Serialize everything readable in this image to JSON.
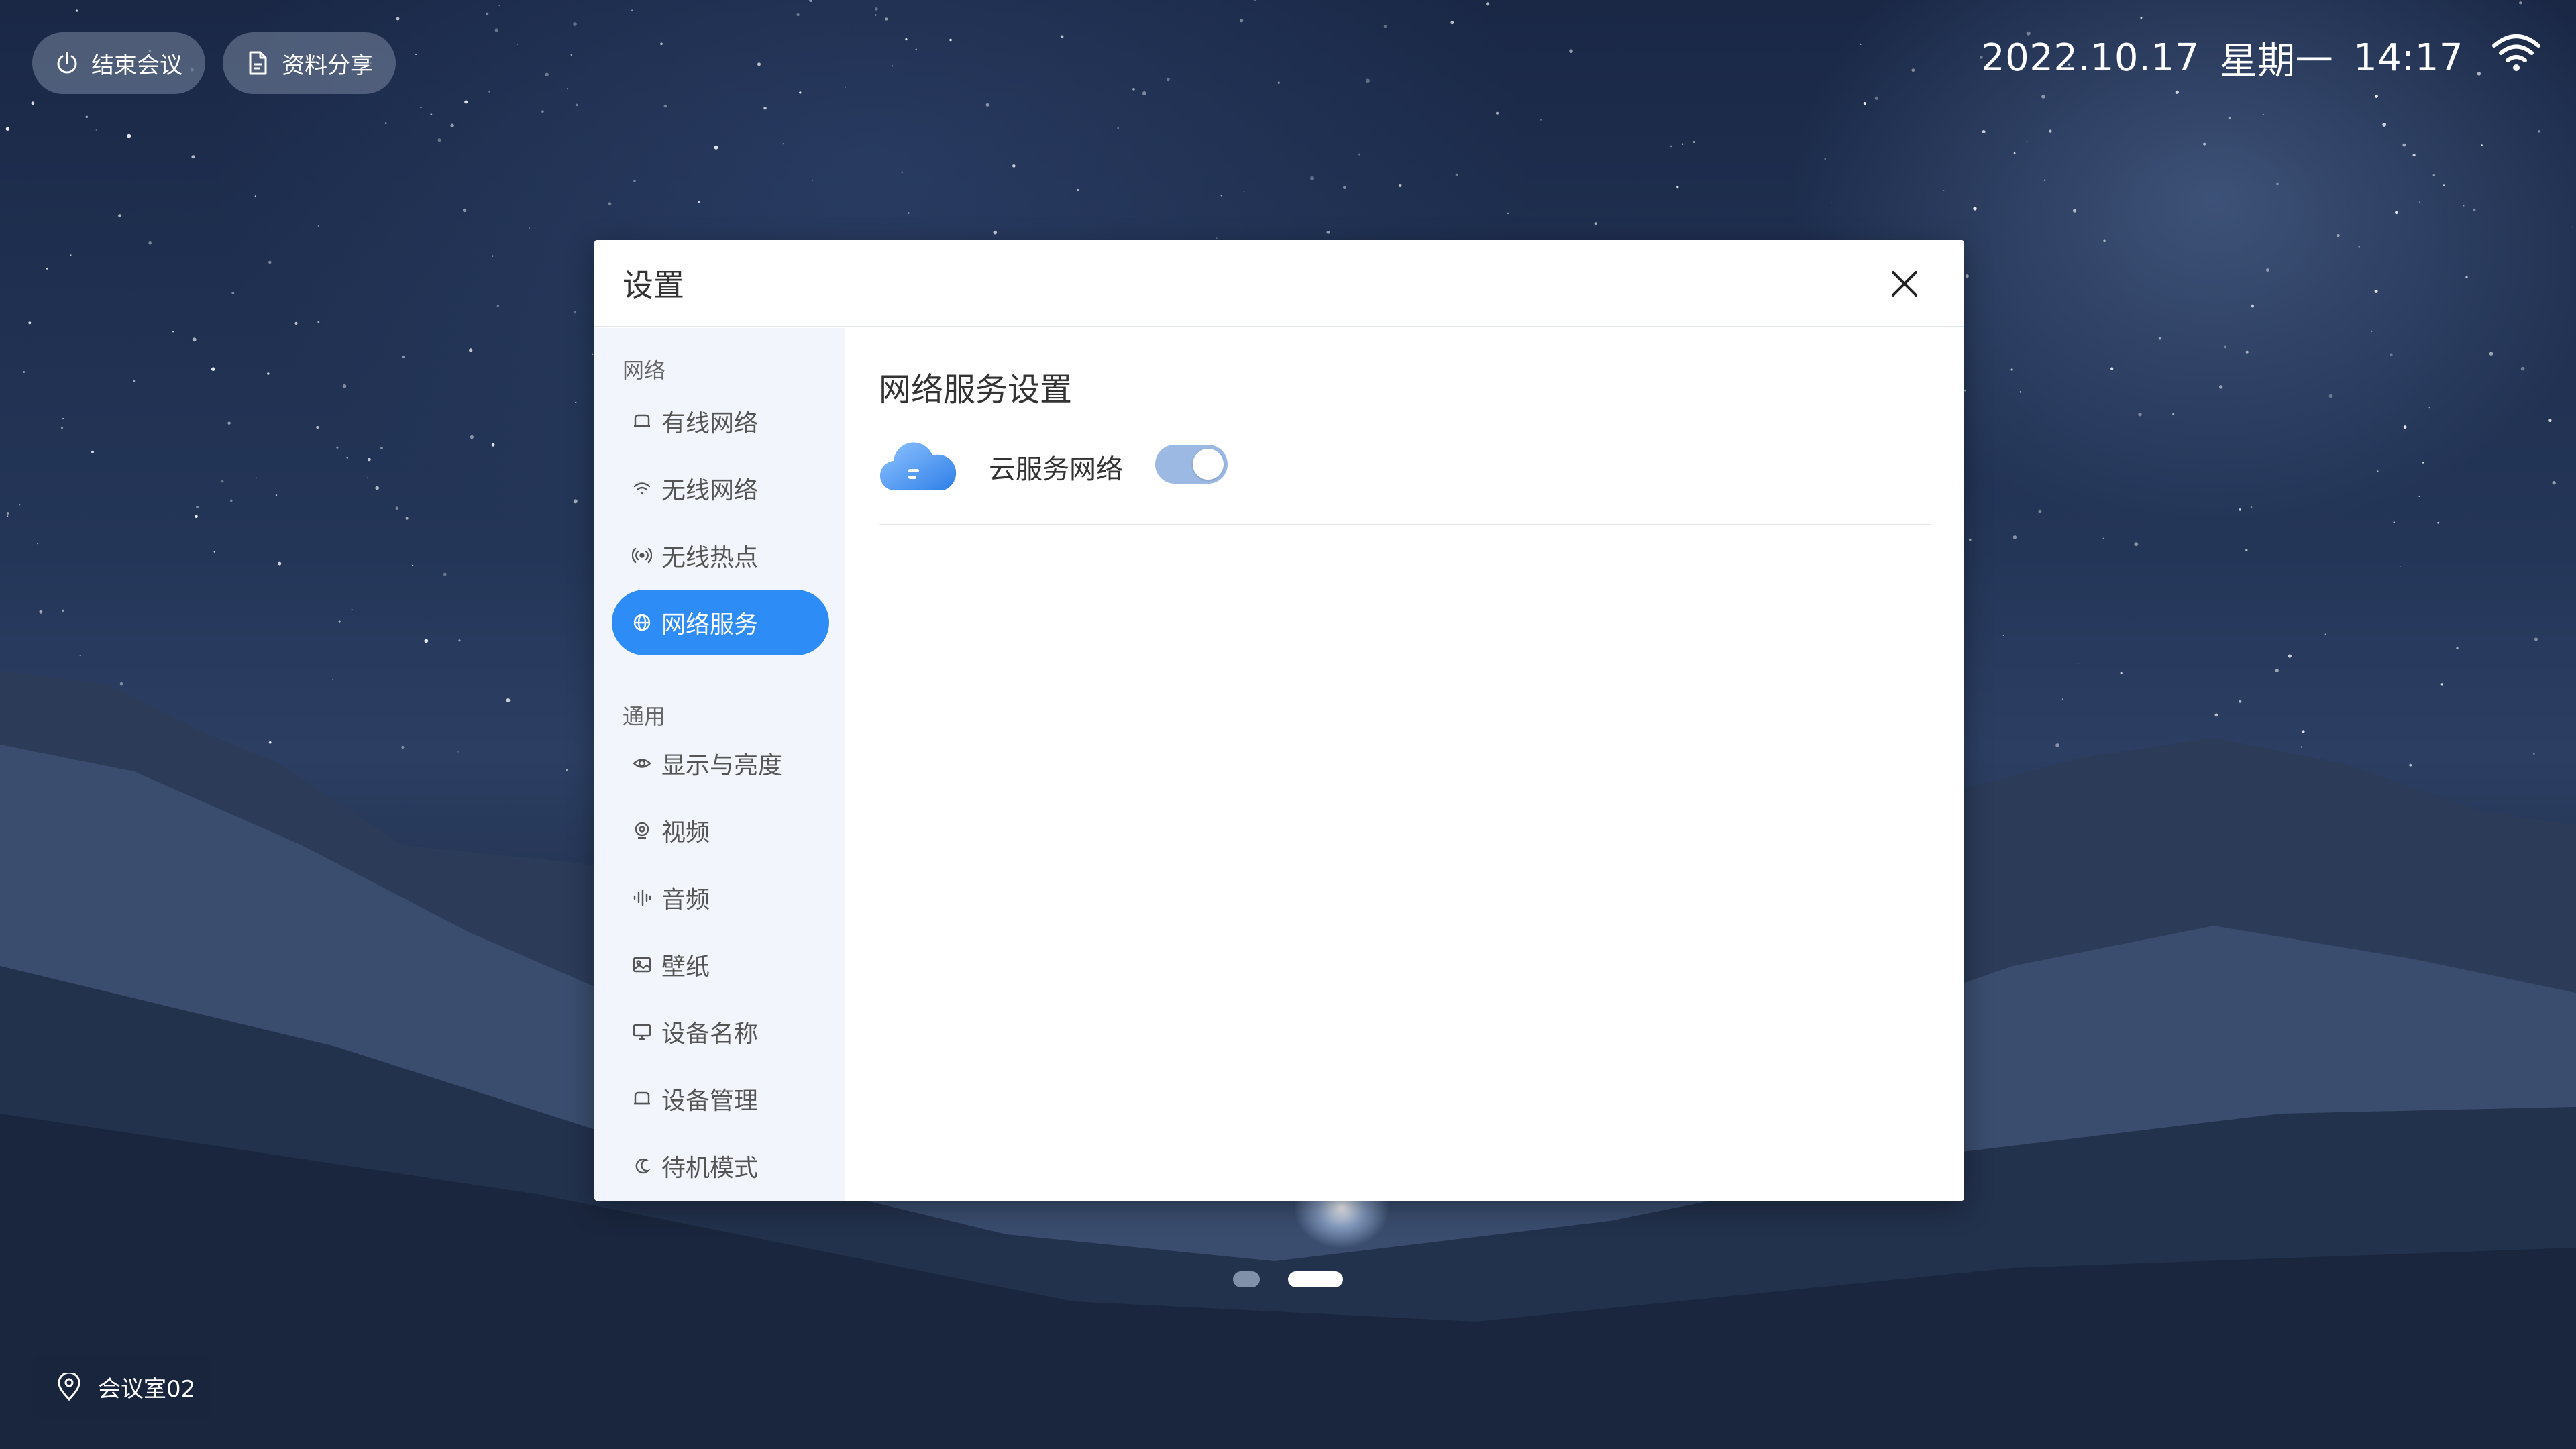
{
  "topbar": {
    "end_meeting_label": "结束会议",
    "end_meeting_icon": "power-icon",
    "share_label": "资料分享",
    "share_icon": "document-icon",
    "date": "2022.10.17",
    "weekday": "星期一",
    "time": "14:17",
    "wifi_icon": "wifi-icon"
  },
  "room": {
    "name": "会议室02",
    "icon": "location-pin-icon"
  },
  "pager": {
    "pages": 2,
    "current": 2
  },
  "dialog": {
    "title": "设置",
    "close_icon": "close-icon",
    "sidebar": {
      "group_network": "网络",
      "group_general": "通用",
      "items": [
        {
          "label": "有线网络",
          "icon": "ethernet-icon"
        },
        {
          "label": "无线网络",
          "icon": "wifi-icon"
        },
        {
          "label": "无线热点",
          "icon": "hotspot-icon"
        },
        {
          "label": "网络服务",
          "icon": "globe-icon",
          "active": true
        },
        {
          "label": "显示与亮度",
          "icon": "eye-icon"
        },
        {
          "label": "视频",
          "icon": "camera-icon"
        },
        {
          "label": "音频",
          "icon": "audio-icon"
        },
        {
          "label": "壁纸",
          "icon": "image-icon"
        },
        {
          "label": "设备名称",
          "icon": "monitor-icon"
        },
        {
          "label": "设备管理",
          "icon": "device-icon"
        },
        {
          "label": "待机模式",
          "icon": "moon-icon"
        }
      ]
    },
    "content": {
      "title": "网络服务设置",
      "cloud_service": {
        "label": "云服务网络",
        "icon": "cloud-icon",
        "enabled": true
      }
    }
  },
  "colors": {
    "accent": "#2e8cf6",
    "toggle_on": "#9bb9e2",
    "sidebar_bg": "#f2f6fc"
  }
}
